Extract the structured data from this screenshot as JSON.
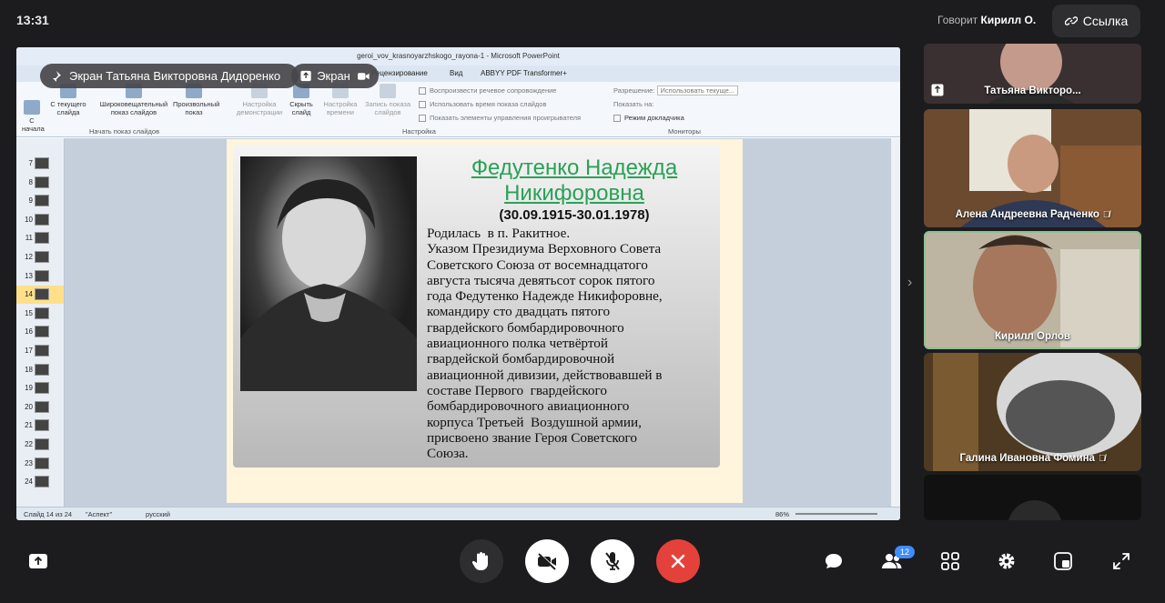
{
  "clock": "13:31",
  "speaker": {
    "prefix": "Говорит",
    "name": "Кирилл О."
  },
  "link_button": {
    "label": "Ссылка"
  },
  "overlays": {
    "screen_owner": "Экран Татьяна Викторовна Дидоренко",
    "screen_button": "Экран"
  },
  "powerpoint": {
    "title": "geroi_vov_krasnoyarzhskogo_rayona-1 - Microsoft PowerPoint",
    "tabs": [
      "Рецензирование",
      "Вид",
      "ABBYY PDF Transformer+"
    ],
    "ribbon": {
      "buttons": [
        "С начала",
        "С текущего слайда",
        "Широковещательный показ слайдов",
        "Произвольный показ",
        "Настройка демонстрации",
        "Скрыть слайд",
        "Настройка времени",
        "Запись показа слайдов"
      ],
      "checks": [
        "Воспроизвести речевое сопровождение",
        "Использовать время показа слайдов",
        "Показать элементы управления проигрывателя"
      ],
      "monitor_labels": [
        "Разрешение:",
        "Показать на:",
        "Режим докладчика"
      ],
      "resolution_value": "Использовать текуще...",
      "groups": [
        "Начать показ слайдов",
        "Настройка",
        "Мониторы"
      ]
    },
    "thumbnails": [
      "7",
      "8",
      "9",
      "10",
      "11",
      "12",
      "13",
      "14",
      "15",
      "16",
      "17",
      "18",
      "19",
      "20",
      "21",
      "22",
      "23",
      "24"
    ],
    "selected_thumbnail": "14",
    "slide": {
      "name_line1": "Федутенко Надежда",
      "name_line2": "Никифоровна",
      "dates": "(30.09.1915-30.01.1978)",
      "bio": "Родилась  в п. Ракитное.\nУказом Президиума Верховного Совета\nСоветского Союза от восемнадцатого\nавгуста тысяча девятьсот сорок пятого\nгода Федутенко Надежде Никифоровне,\nкомандиру сто двадцать пятого\nгвардейского бомбардировочного\nавиационного полка четвёртой\nгвардейской бомбардировочной\nавиационной дивизии, действовавшей в\nсоставе Первого  гвардейского\nбомбардировочного авиационного\nкорпуса Третьей  Воздушной армии,\nприсвоено звание Героя Советского\nСоюза."
    },
    "status": {
      "slide": "Слайд 14 из 24",
      "theme": "\"Аспект\"",
      "lang": "русский",
      "zoom": "86%"
    }
  },
  "participants": [
    {
      "name": "Татьяна Викторо...",
      "muted": false,
      "screen": true
    },
    {
      "name": "Алена Андреевна Радченко",
      "muted": true
    },
    {
      "name": "Кирилл Орлов",
      "muted": false
    },
    {
      "name": "Галина Ивановна Фомина",
      "muted": true
    }
  ],
  "participants_count": "12",
  "colors": {
    "background": "#1c1c1e",
    "end_call": "#e5413b",
    "badge": "#3f8cff",
    "slide_name": "#2aa157"
  }
}
